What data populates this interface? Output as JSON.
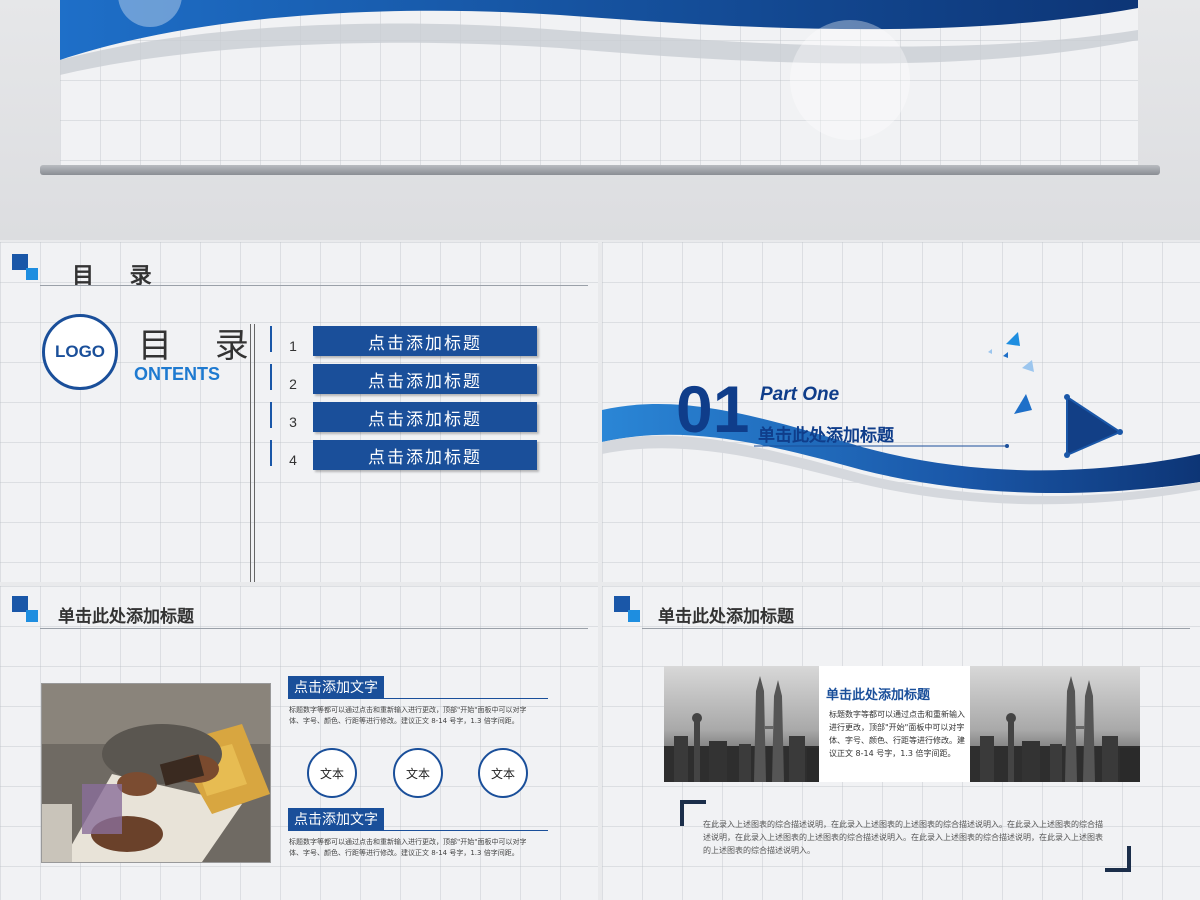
{
  "slide1": {
    "header_title": "目 录",
    "logo_text": "LOGO",
    "toc_title": "目 录",
    "toc_subtitle": "ONTENTS",
    "items": [
      {
        "num": "1",
        "label": "点击添加标题"
      },
      {
        "num": "2",
        "label": "点击添加标题"
      },
      {
        "num": "3",
        "label": "点击添加标题"
      },
      {
        "num": "4",
        "label": "点击添加标题"
      }
    ]
  },
  "slide2": {
    "number": "01",
    "part": "Part One",
    "subtitle": "单击此处添加标题"
  },
  "slide3": {
    "header_title": "单击此处添加标题",
    "label_top": "点击添加文字",
    "text_top": "标题数字等都可以通过点击和重新输入进行更改，顶部\"开始\"面板中可以对字体、字号、颜色、行距等进行修改。建议正文 8-14 号字，1.3 倍字间距。",
    "circles": [
      "文本",
      "文本",
      "文本"
    ],
    "label_bottom": "点击添加文字",
    "text_bottom": "标题数字等都可以通过点击和重新输入进行更改，顶部\"开始\"面板中可以对字体、字号、颜色、行距等进行修改。建议正文 8-14 号字，1.3 倍字间距。"
  },
  "slide4": {
    "header_title": "单击此处添加标题",
    "panel_title": "单击此处添加标题",
    "panel_text": "标题数字等都可以通过点击和重新输入进行更改，顶部\"开始\"面板中可以对字体、字号、颜色、行距等进行修改。建议正文 8-14 号字，1.3 倍字间距。",
    "bottom_text": "在此录入上述图表的综合描述说明，在此录入上述图表的上述图表的综合描述说明入。在此录入上述图表的综合描述说明，在此录入上述图表的上述图表的综合描述说明入。在此录入上述图表的综合描述说明，在此录入上述图表的上述图表的综合描述说明入。"
  },
  "colors": {
    "primary": "#1a4f9a",
    "accent": "#1e8ee0",
    "dark_navy": "#0f3d8a"
  }
}
